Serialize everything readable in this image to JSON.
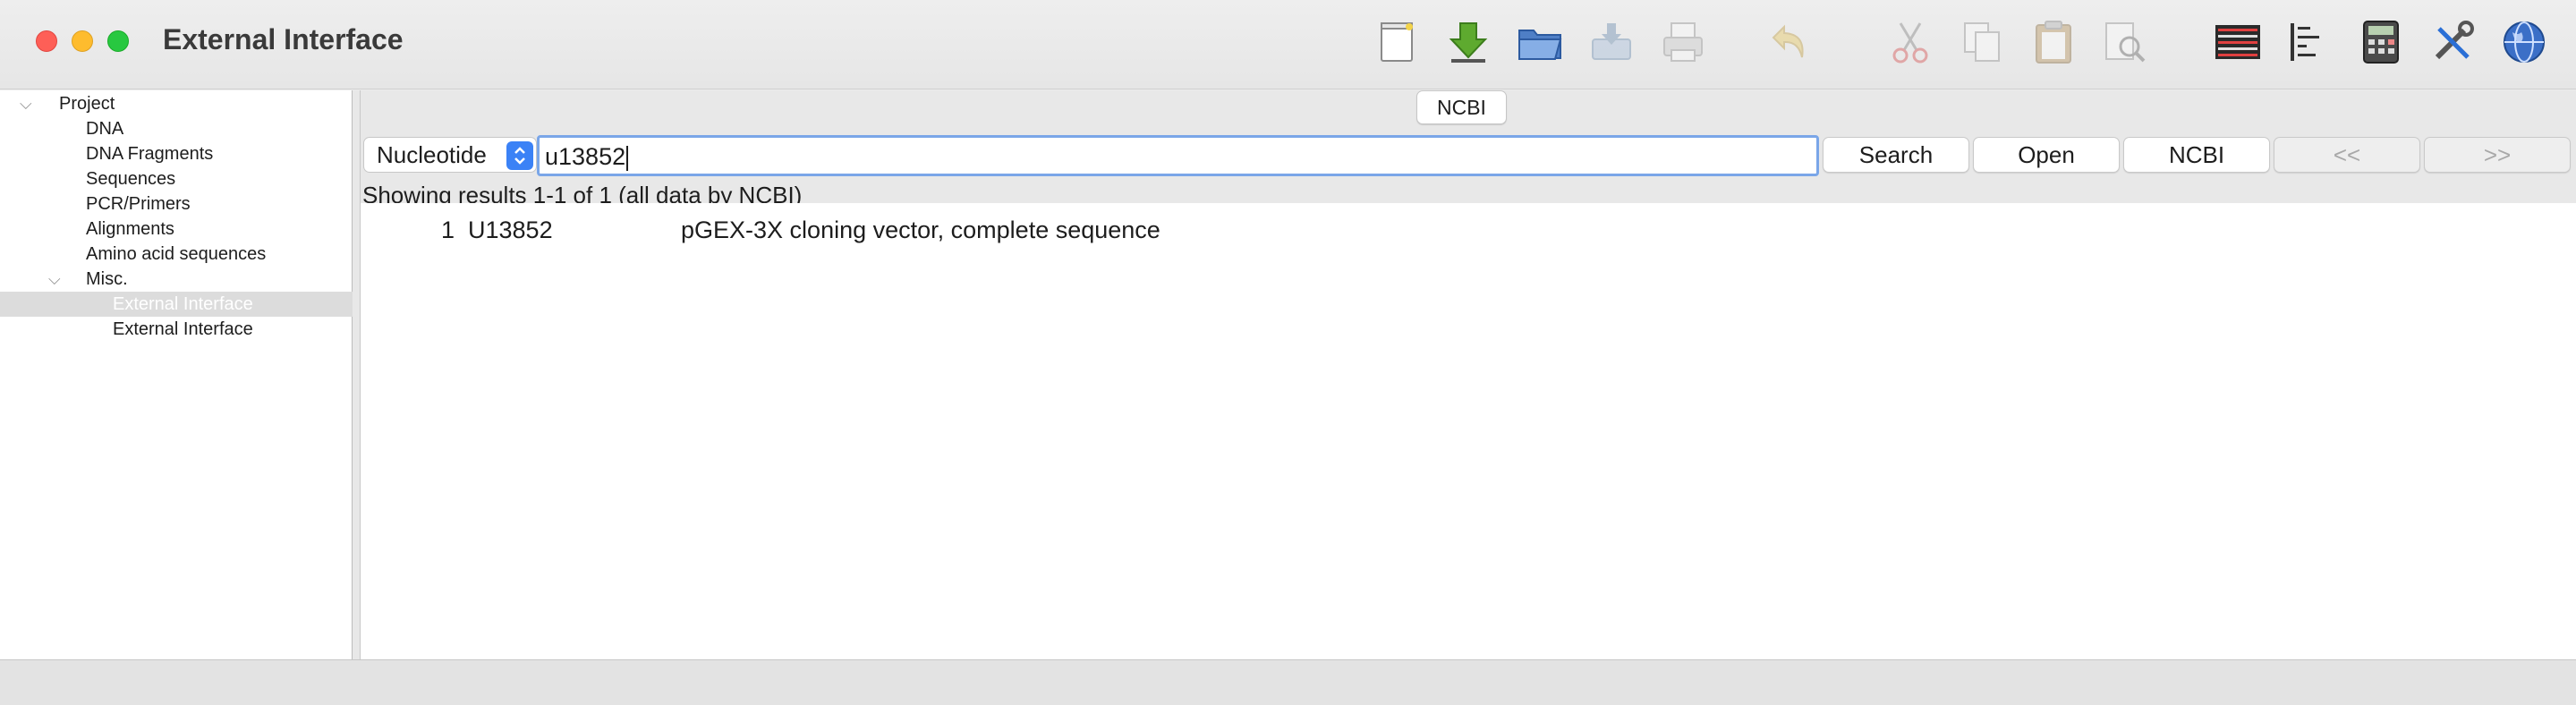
{
  "window": {
    "title": "External Interface"
  },
  "toolbar": {
    "icons": [
      "new-document-icon",
      "download-icon",
      "open-folder-icon",
      "import-icon",
      "print-icon",
      "undo-icon",
      "cut-icon",
      "copy-icon",
      "paste-icon",
      "find-icon",
      "gel-icon",
      "alignment-icon",
      "calculator-icon",
      "tools-icon",
      "globe-icon"
    ]
  },
  "sidebar": {
    "items": [
      {
        "label": "Project",
        "level": 0,
        "expanded": true
      },
      {
        "label": "DNA",
        "level": 1
      },
      {
        "label": "DNA Fragments",
        "level": 1
      },
      {
        "label": "Sequences",
        "level": 1
      },
      {
        "label": "PCR/Primers",
        "level": 1
      },
      {
        "label": "Alignments",
        "level": 1
      },
      {
        "label": "Amino acid sequences",
        "level": 1
      },
      {
        "label": "Misc.",
        "level": 1,
        "expanded": true
      },
      {
        "label": "External Interface",
        "level": 2,
        "selected": true
      },
      {
        "label": "External Interface",
        "level": 2
      }
    ]
  },
  "main": {
    "tab_label": "NCBI",
    "database": {
      "selected": "Nucleotide"
    },
    "search": {
      "value": "u13852"
    },
    "buttons": {
      "search": "Search",
      "open": "Open",
      "ncbi": "NCBI",
      "prev": "<<",
      "next": ">>"
    },
    "status": "Showing results 1-1 of 1 (all data by NCBI)",
    "results": [
      {
        "num": "1",
        "accession": "U13852",
        "description": "pGEX-3X cloning vector, complete sequence"
      }
    ]
  },
  "colors": {
    "accent": "#3b82f6",
    "focus_ring": "#7aa6e8",
    "close": "#fe5f57",
    "minimize": "#febc2e",
    "maximize": "#28c840"
  }
}
